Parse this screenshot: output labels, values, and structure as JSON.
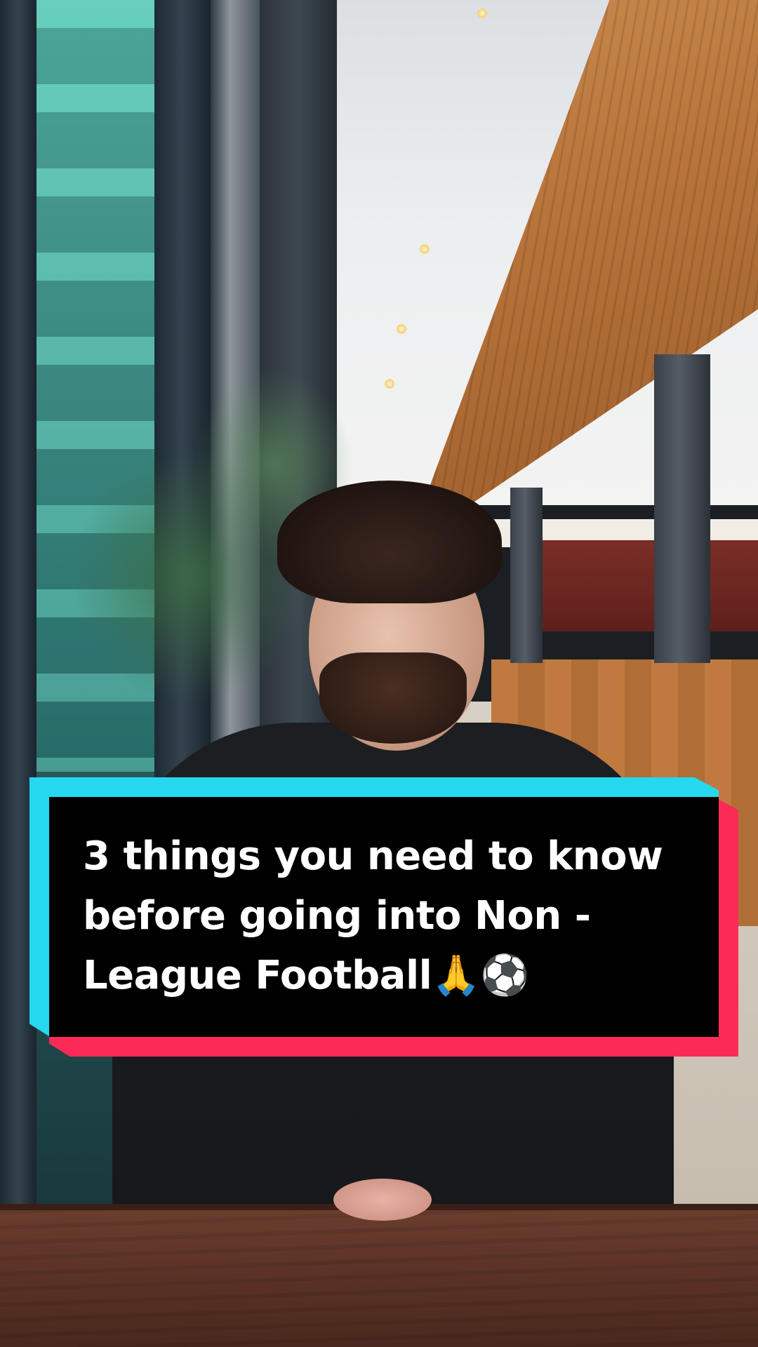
{
  "caption": {
    "text": "3 things you need to know before going into Non - League Football🙏⚽"
  },
  "colors": {
    "card_background": "#000000",
    "card_text": "#ffffff",
    "accent_cyan": "#25d8f0",
    "accent_red": "#fc2b55"
  }
}
